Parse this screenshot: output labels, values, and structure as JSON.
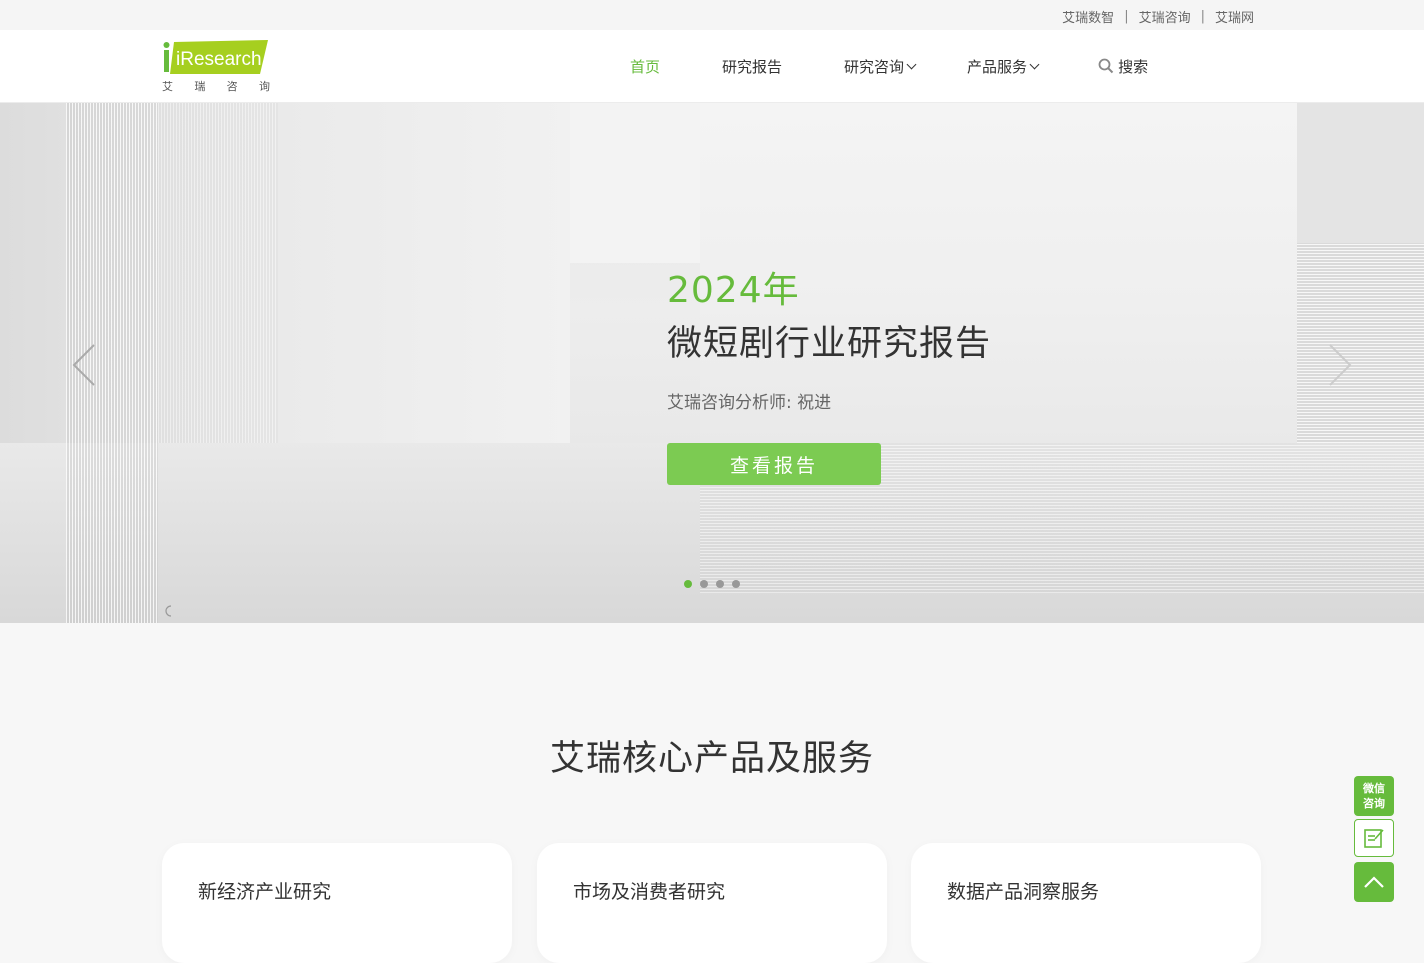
{
  "topbar": {
    "links": [
      "艾瑞数智",
      "艾瑞咨询",
      "艾瑞网"
    ],
    "separator": "|"
  },
  "logo": {
    "brand": "iResearch",
    "subtitle_chars": [
      "艾",
      "瑞",
      "咨",
      "询"
    ]
  },
  "nav": {
    "items": [
      {
        "label": "首页",
        "active": true,
        "dropdown": false
      },
      {
        "label": "研究报告",
        "active": false,
        "dropdown": false
      },
      {
        "label": "研究咨询",
        "active": false,
        "dropdown": true
      },
      {
        "label": "产品服务",
        "active": false,
        "dropdown": true
      }
    ],
    "search_label": "搜索",
    "search_icon": "search-icon"
  },
  "hero": {
    "year": "2024年",
    "title": "微短剧行业研究报告",
    "analyst": "艾瑞咨询分析师:  祝进",
    "button_label": "查看报告",
    "slide_count": 4,
    "active_slide": 1
  },
  "products": {
    "title": "艾瑞核心产品及服务",
    "cards": [
      {
        "title": "新经济产业研究"
      },
      {
        "title": "市场及消费者研究"
      },
      {
        "title": "数据产品洞察服务"
      }
    ]
  },
  "float_tools": {
    "wechat_line1": "微信",
    "wechat_line2": "咨询"
  },
  "colors": {
    "brand_green": "#66bb3c",
    "button_green": "#7ccb52",
    "text_dark": "#333333"
  }
}
